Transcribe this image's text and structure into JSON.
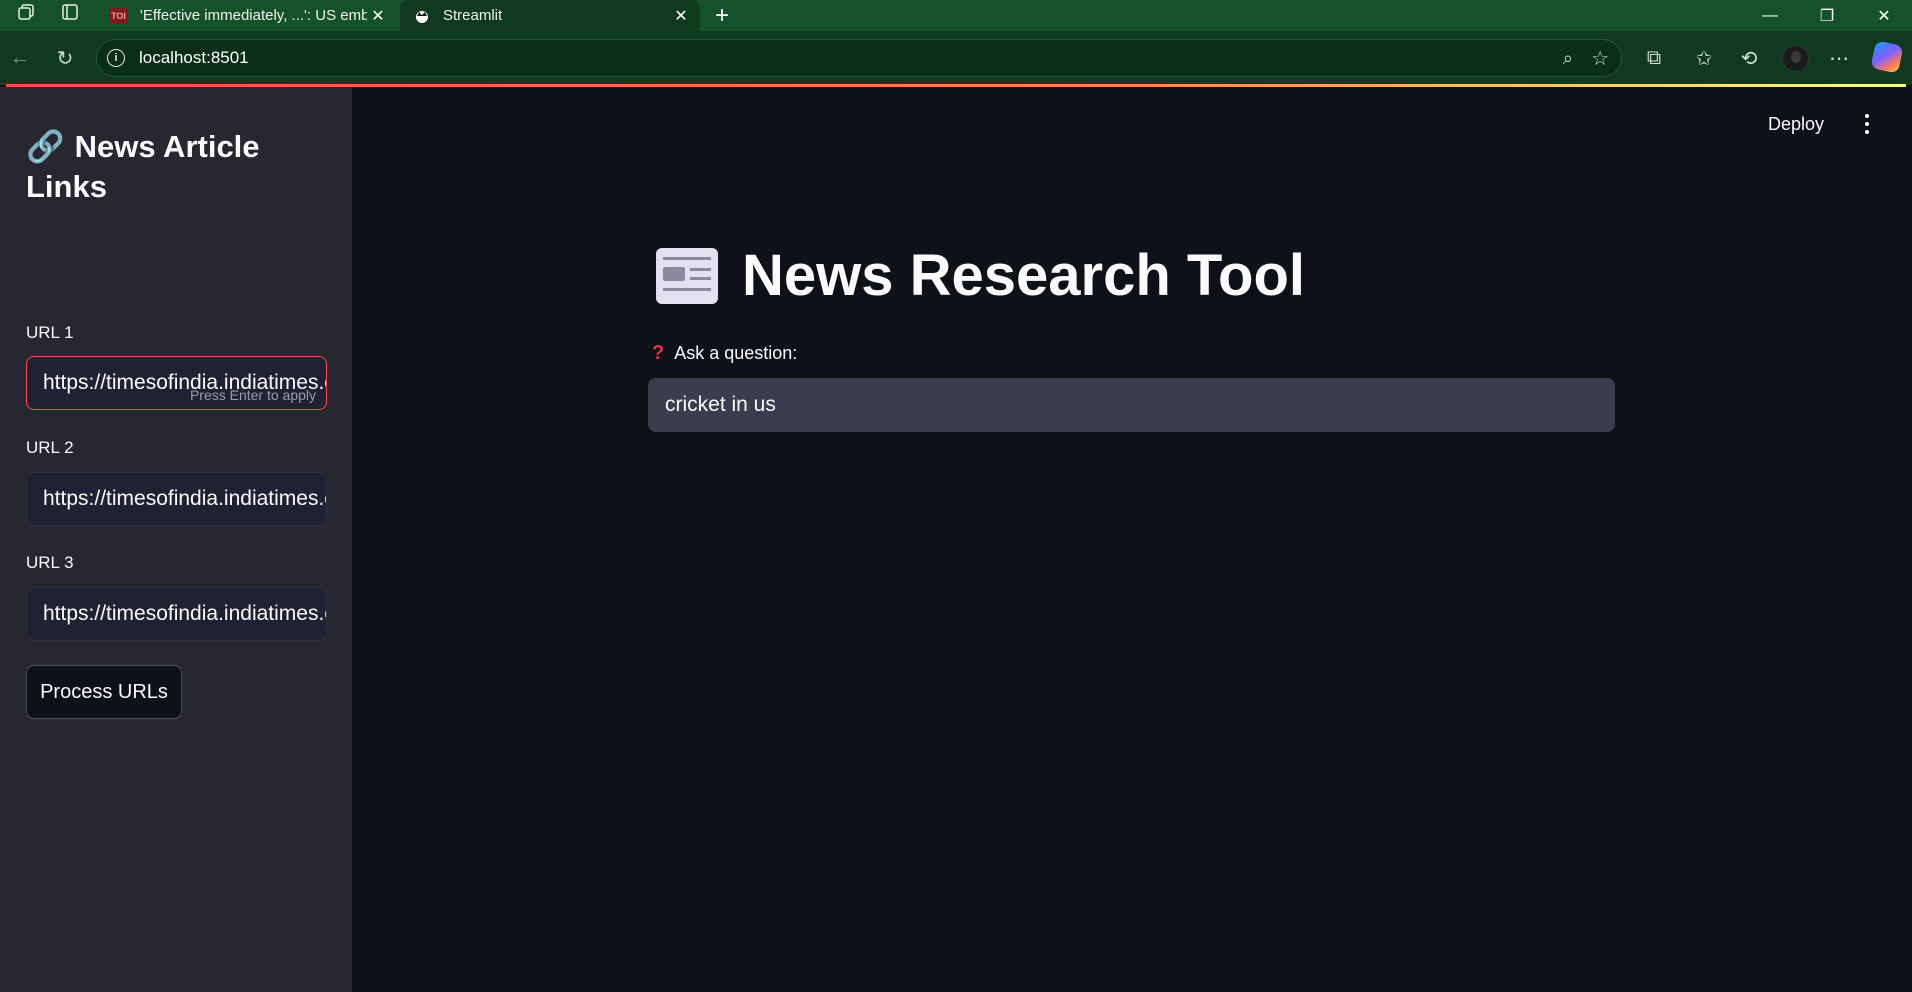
{
  "browser": {
    "tabs": [
      {
        "favicon": "TOI",
        "title": "'Effective immediately, ...': US emb",
        "active": false
      },
      {
        "favicon": "streamlit-crown-icon",
        "title": "Streamlit",
        "active": true
      }
    ],
    "address": "localhost:8501"
  },
  "app": {
    "header": {
      "deploy_label": "Deploy"
    },
    "sidebar": {
      "title_icon": "🔗",
      "title": "News Article Links",
      "inputs": [
        {
          "label": "URL 1",
          "value": "https://timesofindia.indiatimes.com",
          "hint": "Press Enter to apply"
        },
        {
          "label": "URL 2",
          "value": "https://timesofindia.indiatimes.com"
        },
        {
          "label": "URL 3",
          "value": "https://timesofindia.indiatimes.com"
        }
      ],
      "process_button": "Process URLs"
    },
    "main": {
      "title": "News Research Tool",
      "question_label": "Ask a question:",
      "question_value": "cricket in us"
    }
  },
  "colors": {
    "accent": "#ff4b4b",
    "sidebar_bg": "#262730",
    "main_bg": "#0e1117",
    "browser_frame": "#15512b"
  }
}
